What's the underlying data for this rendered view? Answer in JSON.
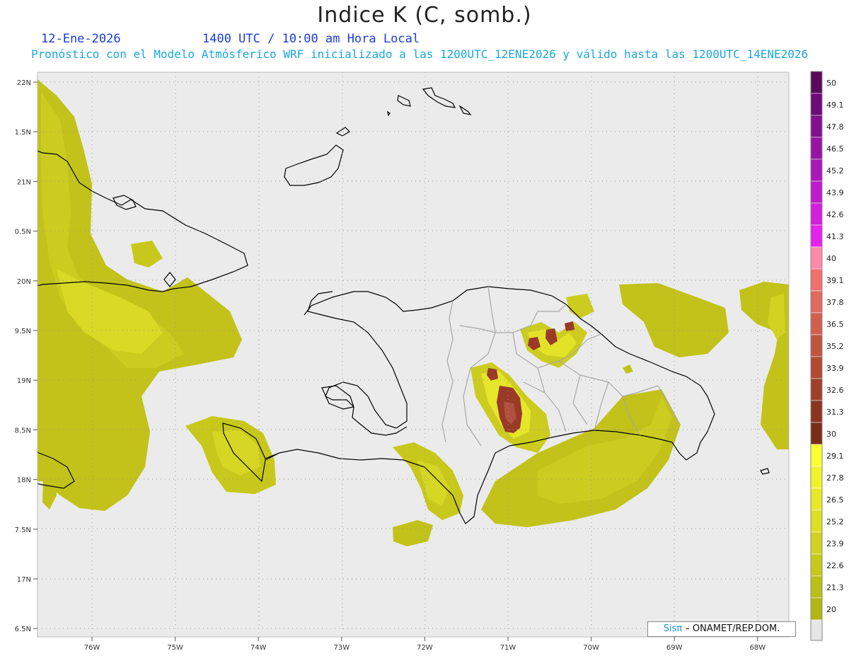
{
  "header": {
    "title": "Indice K (C, somb.)",
    "date": "12-Ene-2026",
    "time": "1400 UTC / 10:00 am Hora Local",
    "description": "Pronóstico con el Modelo Atmósferico WRF inicializado a las 1200UTC_12ENE2026 y válido hasta las  1200UTC_14ENE2026"
  },
  "map": {
    "lat_labels": [
      "22N",
      "1.5N",
      "21N",
      "0.5N",
      "20N",
      "9.5N",
      "19N",
      "8.5N",
      "18N",
      "7.5N",
      "17N",
      "6.5N"
    ],
    "lon_labels": [
      "76W",
      "75W",
      "74W",
      "73W",
      "72W",
      "71W",
      "70W",
      "69W",
      "68W"
    ],
    "background_color": "#ebebeb",
    "coast_color": "#000000",
    "province_color": "#a8a8a8"
  },
  "colorbar": {
    "labels": [
      "50",
      "49.1",
      "47.8",
      "46.5",
      "45.2",
      "43.9",
      "42.6",
      "41.3",
      "40",
      "39.1",
      "37.8",
      "36.5",
      "35.2",
      "33.9",
      "32.6",
      "31.3",
      "30",
      "29.1",
      "27.8",
      "26.5",
      "25.2",
      "23.9",
      "22.6",
      "21.3",
      "20"
    ],
    "colors": [
      "#5a0a5a",
      "#6e0a7a",
      "#82108e",
      "#9614a4",
      "#aa18b8",
      "#be1cca",
      "#d220dc",
      "#e622ee",
      "#ff88aa",
      "#f07070",
      "#e06a5e",
      "#d0604e",
      "#c0553e",
      "#b04a32",
      "#a03f28",
      "#8a3520",
      "#7a2c14",
      "#ffff30",
      "#f2f22c",
      "#e8e828",
      "#dede24",
      "#d2d220",
      "#c8c81c",
      "#bebe18",
      "#b4b414"
    ],
    "bottom_color": "#e6e6e6"
  },
  "credit": {
    "logo": "Sisπ",
    "text": " – ONAMET/REP.DOM."
  }
}
